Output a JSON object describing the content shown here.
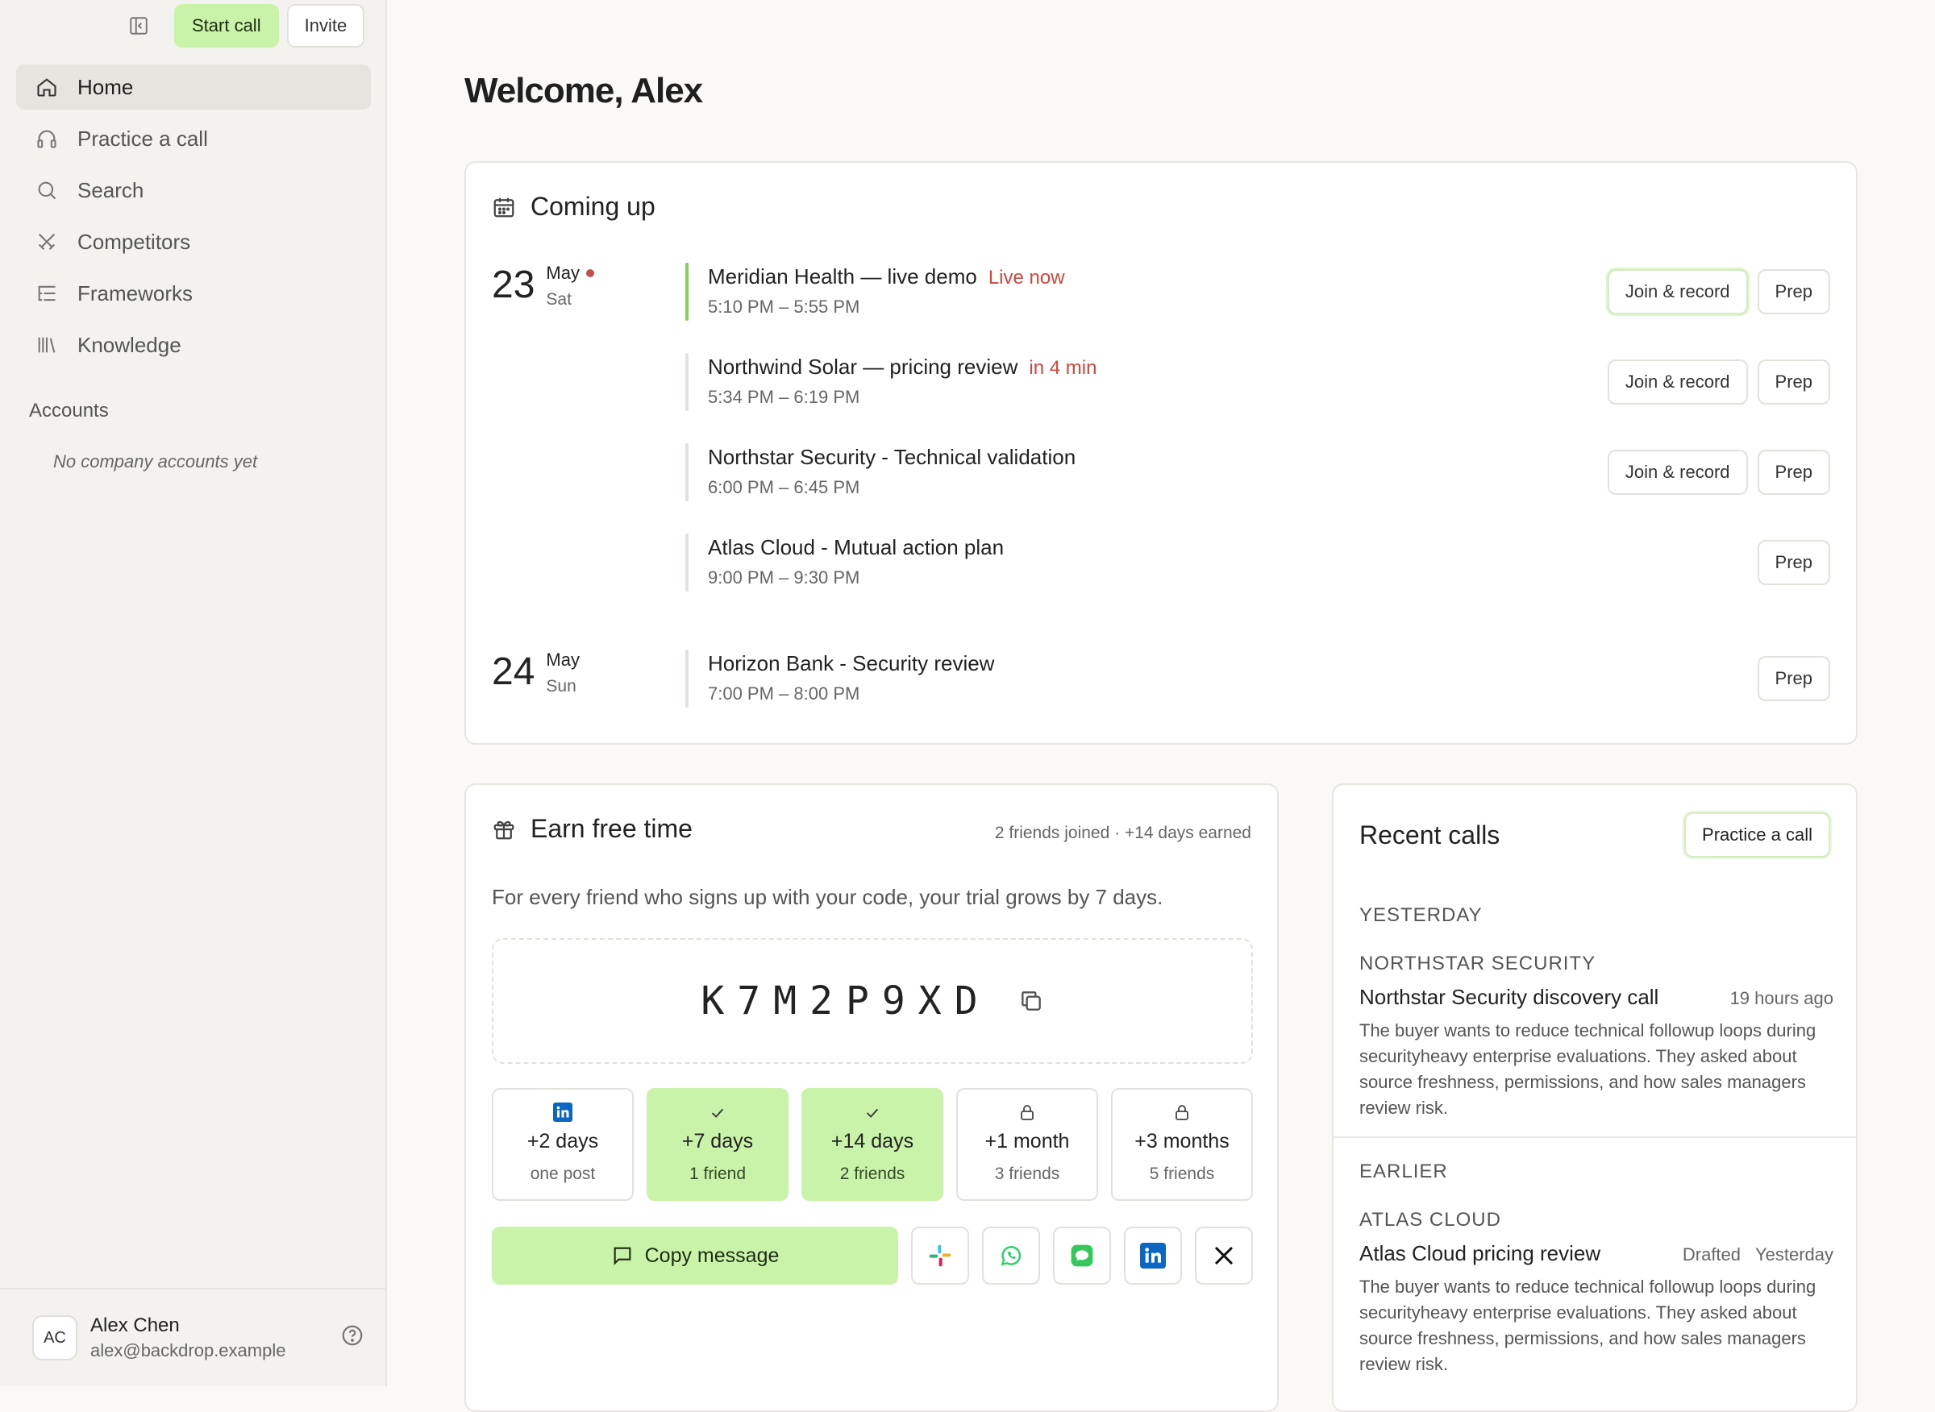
{
  "topbar": {
    "start_call": "Start call",
    "invite": "Invite"
  },
  "nav": {
    "home": "Home",
    "practice": "Practice a call",
    "search": "Search",
    "competitors": "Competitors",
    "frameworks": "Frameworks",
    "knowledge": "Knowledge"
  },
  "accounts": {
    "title": "Accounts",
    "empty": "No company accounts yet"
  },
  "user": {
    "initials": "AC",
    "name": "Alex Chen",
    "email": "alex@backdrop.example"
  },
  "welcome": "Welcome, Alex",
  "coming_up": {
    "title": "Coming up",
    "days": [
      {
        "num": "23",
        "month": "May",
        "weekday": "Sat"
      },
      {
        "num": "24",
        "month": "May",
        "weekday": "Sun"
      }
    ],
    "events": [
      {
        "title": "Meridian Health — live demo",
        "status": "Live now",
        "time": "5:10 PM – 5:55 PM",
        "join": "Join & record",
        "prep": "Prep"
      },
      {
        "title": "Northwind Solar — pricing review",
        "status": "in 4 min",
        "time": "5:34 PM – 6:19 PM",
        "join": "Join & record",
        "prep": "Prep"
      },
      {
        "title": "Northstar Security - Technical validation",
        "time": "6:00 PM – 6:45 PM",
        "join": "Join & record",
        "prep": "Prep"
      },
      {
        "title": "Atlas Cloud - Mutual action plan",
        "time": "9:00 PM – 9:30 PM",
        "prep": "Prep"
      },
      {
        "title": "Horizon Bank - Security review",
        "time": "7:00 PM – 8:00 PM",
        "prep": "Prep"
      }
    ]
  },
  "earn": {
    "title": "Earn free time",
    "meta": "2 friends joined · +14 days earned",
    "description": "For every friend who signs up with your code, your trial grows by 7 days.",
    "code": "K7M2P9XD",
    "rewards": [
      {
        "value": "+2 days",
        "req": "one post"
      },
      {
        "value": "+7 days",
        "req": "1 friend"
      },
      {
        "value": "+14 days",
        "req": "2 friends"
      },
      {
        "value": "+1 month",
        "req": "3 friends"
      },
      {
        "value": "+3 months",
        "req": "5 friends"
      }
    ],
    "copy_message": "Copy message"
  },
  "recent": {
    "title": "Recent calls",
    "practice": "Practice a call",
    "groups": [
      {
        "label": "YESTERDAY",
        "account": "NORTHSTAR SECURITY",
        "call_title": "Northstar Security discovery call",
        "when": "19 hours ago",
        "summary": "The buyer wants to reduce technical followup loops during securityheavy enterprise evaluations. They asked about source freshness, permissions, and how sales managers review risk."
      },
      {
        "label": "EARLIER",
        "account": "ATLAS CLOUD",
        "call_title": "Atlas Cloud pricing review",
        "when": "Drafted   Yesterday",
        "summary": "The buyer wants to reduce technical followup loops during securityheavy enterprise evaluations. They asked about source freshness, permissions, and how sales managers review risk."
      }
    ]
  },
  "colors": {
    "accent": "#c8f3a9",
    "live": "#86d05d",
    "alert": "#d2463c"
  }
}
